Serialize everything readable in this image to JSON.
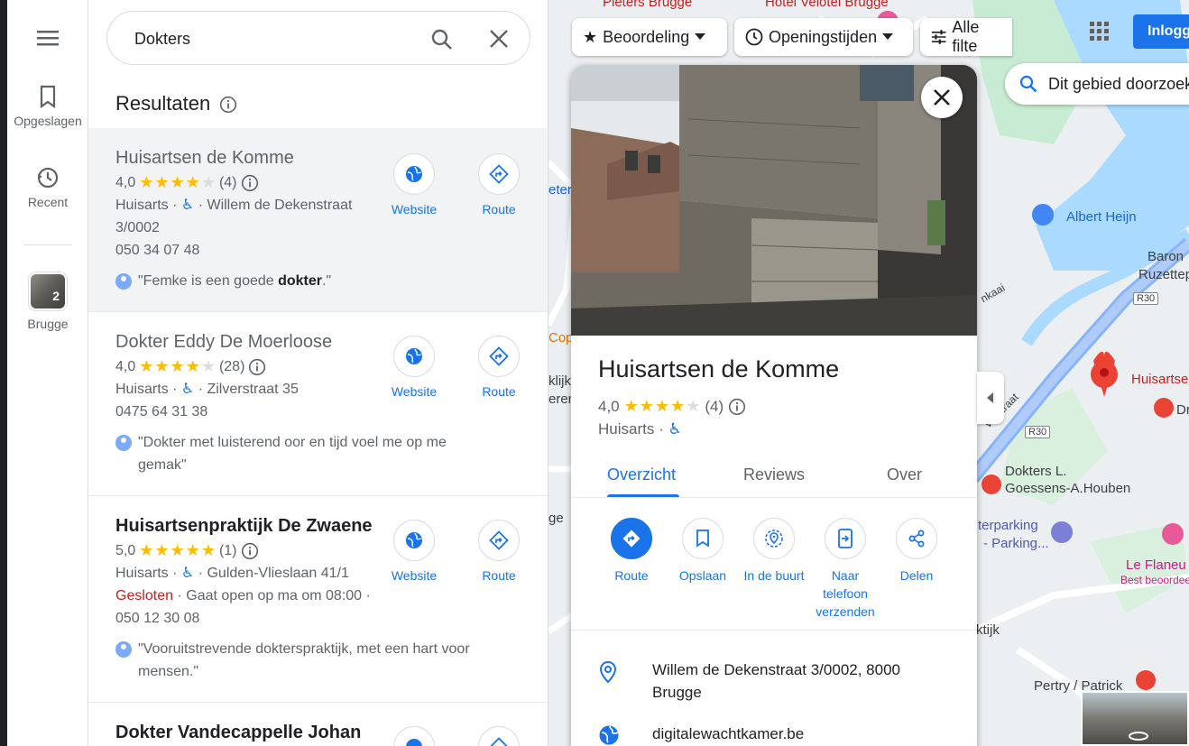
{
  "rail": {
    "saved_label": "Opgeslagen",
    "recent_label": "Recent",
    "recent_place": {
      "label": "Brugge",
      "count": "2"
    }
  },
  "search": {
    "value": "Dokters"
  },
  "results": {
    "heading": "Resultaten",
    "website_label": "Website",
    "route_label": "Route",
    "items": [
      {
        "name": "Huisartsen de Komme",
        "rating": "4,0",
        "stars": 4,
        "reviews": "(4)",
        "category": "Huisarts",
        "address": "Willem de Dekenstraat 3/0002",
        "phone": "050 34 07 48",
        "quote_pre": "\"Femke is een goede ",
        "quote_bold": "dokter",
        "quote_post": ".\""
      },
      {
        "name": "Dokter Eddy De Moerloose",
        "rating": "4,0",
        "stars": 4,
        "reviews": "(28)",
        "category": "Huisarts",
        "address": "Zilverstraat 35",
        "phone": "0475 64 31 38",
        "quote": "\"Dokter met luisterend oor en tijd voel me op me gemak\""
      },
      {
        "name": "Huisartsenpraktijk De Zwaene",
        "rating": "5,0",
        "stars": 5,
        "reviews": "(1)",
        "category": "Huisarts",
        "address": "Gulden-Vlieslaan 41/1",
        "status": "Gesloten",
        "opens": "Gaat open op ma om 08:00",
        "phone": "050 12 30 08",
        "quote": "\"Vooruitstrevende dokterspraktijk, met een hart voor mensen.\""
      },
      {
        "name": "Dokter Vandecappelle Johan"
      }
    ]
  },
  "filters": {
    "rating": "Beoordeling",
    "hours": "Openingstijden",
    "all": "Alle filte"
  },
  "map": {
    "login": "Inlogg",
    "area_search": "Dit gebied doorzoek",
    "labels": {
      "albert_heijn": "Albert Heijn",
      "baron": "Baron",
      "ruzettep": "Ruzettep",
      "r30_a": "R30",
      "r30_b": "R30",
      "huisartsen_pin": "Huisartse",
      "dokters_1": "Dokters L.",
      "dokters_2": "Goessens-A.Houben",
      "parking_1": "terparking",
      "parking_2": "- Parking...",
      "flaneur": "Le Flaneu",
      "flaneur_sub": "Best beoordee",
      "pertry": "Pertry / Patrick",
      "weststraat": "Westraat",
      "enkaai": "nkaai",
      "tijk": "ktijk",
      "pieters": "Pieters Brugge",
      "hotel": "Hotel Velotel Brugge",
      "klijk": "klijk",
      "eren": "eren",
      "dr": "Dr",
      "cop": "Cop",
      "ge": "ge",
      "eter": "eter"
    }
  },
  "detail": {
    "title": "Huisartsen de Komme",
    "rating": "4,0",
    "stars": 4,
    "reviews": "(4)",
    "category": "Huisarts",
    "tabs": [
      "Overzicht",
      "Reviews",
      "Over"
    ],
    "actions": [
      "Route",
      "Opslaan",
      "In de buurt",
      "Naar telefoon verzenden",
      "Delen"
    ],
    "address": "Willem de Dekenstraat 3/0002, 8000 Brugge",
    "website": "digitalewachtkamer.be"
  },
  "colors": {
    "accent": "#1a73e8",
    "star": "#fbbc04",
    "closed": "#c5221f",
    "pin": "#ea4335"
  }
}
